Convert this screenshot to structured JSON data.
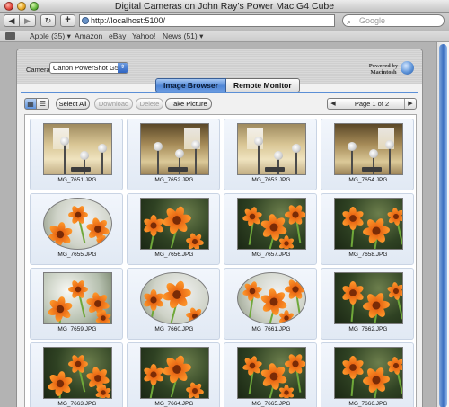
{
  "window": {
    "title": "Digital Cameras on John Ray's Power Mac G4 Cube"
  },
  "toolbar": {
    "back_glyph": "◀",
    "forward_glyph": "▶",
    "reload_glyph": "↻",
    "add_glyph": "+",
    "url": "http://localhost:5100/",
    "search_placeholder": "Google"
  },
  "bookmarks": [
    {
      "label": "Apple (35) ▾"
    },
    {
      "label": "Amazon"
    },
    {
      "label": "eBay"
    },
    {
      "label": "Yahoo!"
    },
    {
      "label": "News (51) ▾"
    }
  ],
  "app": {
    "camera_label": "Camera",
    "camera_selected": "Canon PowerShot G5",
    "powered_by_line1": "Powered by",
    "powered_by_line2": "Macintosh",
    "tabs": [
      {
        "label": "Image Browser",
        "active": true
      },
      {
        "label": "Remote Monitor",
        "active": false
      }
    ],
    "buttons": {
      "select_all": "Select All",
      "download": "Download",
      "delete": "Delete",
      "take_picture": "Take Picture"
    },
    "pager": {
      "label": "Page 1 of 2",
      "prev_glyph": "◀",
      "next_glyph": "▶"
    },
    "accent_color": "#4f86d6"
  },
  "images": [
    {
      "name": "IMG_7651.JPG",
      "kind": "room"
    },
    {
      "name": "IMG_7652.JPG",
      "kind": "room-dark"
    },
    {
      "name": "IMG_7653.JPG",
      "kind": "room"
    },
    {
      "name": "IMG_7654.JPG",
      "kind": "room-dark"
    },
    {
      "name": "IMG_7655.JPG",
      "kind": "flower-light"
    },
    {
      "name": "IMG_7656.JPG",
      "kind": "flower"
    },
    {
      "name": "IMG_7657.JPG",
      "kind": "flower"
    },
    {
      "name": "IMG_7658.JPG",
      "kind": "flower"
    },
    {
      "name": "IMG_7659.JPG",
      "kind": "flower-bright"
    },
    {
      "name": "IMG_7660.JPG",
      "kind": "flower-light"
    },
    {
      "name": "IMG_7661.JPG",
      "kind": "flower-light"
    },
    {
      "name": "IMG_7662.JPG",
      "kind": "flower"
    },
    {
      "name": "IMG_7663.JPG",
      "kind": "flower"
    },
    {
      "name": "IMG_7664.JPG",
      "kind": "flower"
    },
    {
      "name": "IMG_7665.JPG",
      "kind": "flower"
    },
    {
      "name": "IMG_7666.JPG",
      "kind": "flower"
    }
  ]
}
